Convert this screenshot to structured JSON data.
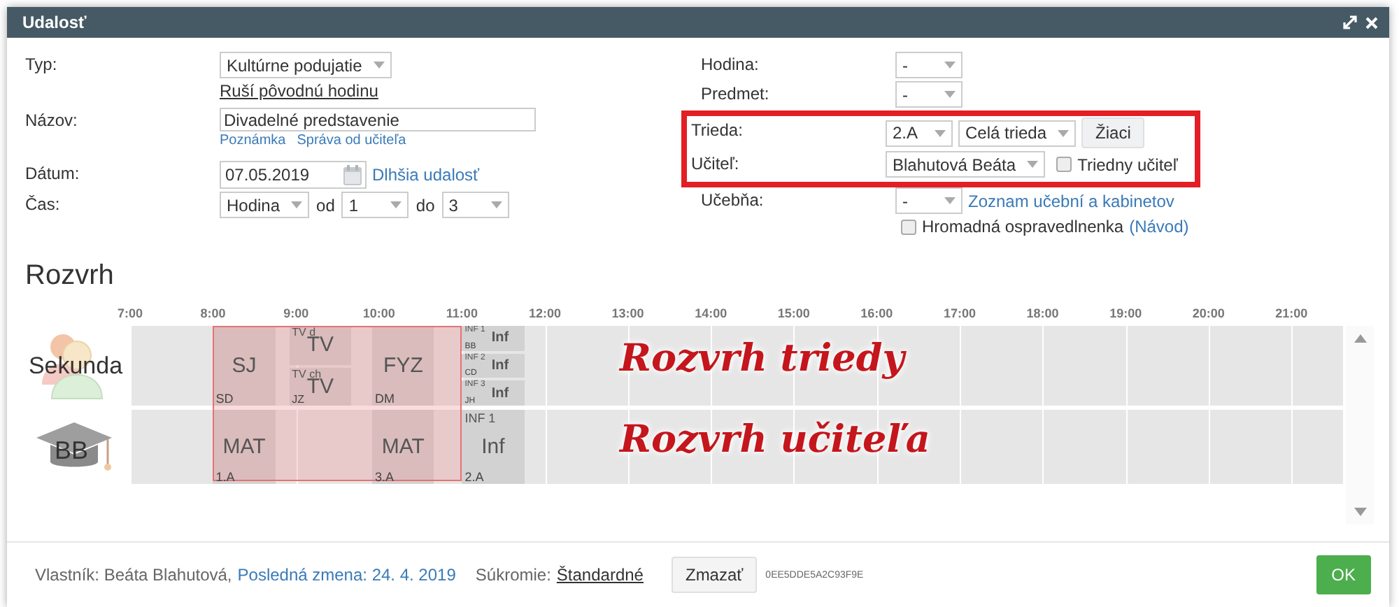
{
  "window": {
    "title": "Udalosť"
  },
  "form_left": [
    {
      "label": "Typ:",
      "controls": [
        {
          "kind": "select",
          "value": "Kultúrne podujatie"
        }
      ]
    },
    {
      "controls": [
        {
          "kind": "underlined_link",
          "text": "Ruší pôvodnú hodinu"
        }
      ]
    },
    {
      "label": "Názov:",
      "controls": [
        {
          "kind": "input",
          "value": "Divadelné predstavenie"
        }
      ]
    },
    {
      "controls": [
        {
          "kind": "small_link",
          "text": "Poznámka"
        },
        {
          "kind": "small_link",
          "text": "Správa od učiteľa"
        }
      ]
    },
    {
      "label": "Dátum:",
      "controls": [
        {
          "kind": "date",
          "value": "07.05.2019"
        },
        {
          "kind": "link",
          "text": "Dlhšia udalosť"
        }
      ]
    },
    {
      "label": "Čas:",
      "controls": [
        {
          "kind": "select",
          "value": "Hodina"
        },
        {
          "kind": "text",
          "text": "od"
        },
        {
          "kind": "select",
          "value": "1"
        },
        {
          "kind": "text",
          "text": "do"
        },
        {
          "kind": "select",
          "value": "3"
        }
      ]
    }
  ],
  "form_right": [
    {
      "label": "Hodina:",
      "highlighted": false,
      "controls": [
        {
          "kind": "select",
          "value": "-"
        }
      ]
    },
    {
      "label": "Predmet:",
      "highlighted": false,
      "controls": [
        {
          "kind": "select",
          "value": "-"
        }
      ]
    },
    {
      "label": "Trieda:",
      "highlighted": true,
      "controls": [
        {
          "kind": "select",
          "value": "2.A"
        },
        {
          "kind": "select",
          "value": "Celá trieda"
        },
        {
          "kind": "button",
          "text": "Žiaci"
        }
      ]
    },
    {
      "label": "Učiteľ:",
      "highlighted": true,
      "controls": [
        {
          "kind": "select",
          "value": "Blahutová Beáta"
        },
        {
          "kind": "checkbox",
          "text": "Triedny učiteľ",
          "checked": false
        }
      ]
    },
    {
      "label": "Učebňa:",
      "highlighted": false,
      "controls": [
        {
          "kind": "select",
          "value": "-"
        },
        {
          "kind": "link",
          "text": "Zoznam učební a kabinetov"
        }
      ]
    },
    {
      "highlighted": false,
      "controls": [
        {
          "kind": "checkbox",
          "text": "Hromadná ospravedlnenka",
          "checked": false
        },
        {
          "kind": "link",
          "text": "(Návod)"
        }
      ]
    }
  ],
  "schedule": {
    "title": "Rozvrh",
    "hours": [
      "7:00",
      "8:00",
      "9:00",
      "10:00",
      "11:00",
      "12:00",
      "13:00",
      "14:00",
      "15:00",
      "16:00",
      "17:00",
      "18:00",
      "19:00",
      "20:00",
      "21:00"
    ],
    "rows": [
      {
        "kind": "class",
        "label": "Sekunda",
        "annotation": "Rozvrh triedy",
        "cells": [
          {
            "kind": "lesson",
            "selected": true,
            "entries": [
              {
                "subject": "SJ",
                "note": "SD"
              }
            ]
          },
          {
            "kind": "lesson",
            "selected": true,
            "entries": [
              {
                "group": "TV d",
                "subject": "TV"
              },
              {
                "group": "TV ch",
                "subject": "TV",
                "note": "JZ"
              }
            ]
          },
          {
            "kind": "lesson",
            "selected": true,
            "entries": [
              {
                "subject": "FYZ",
                "note": "DM"
              }
            ]
          },
          {
            "kind": "lesson",
            "selected": false,
            "entries": [
              {
                "group": "INF 1",
                "subject": "Inf",
                "note": "BB"
              },
              {
                "group": "INF 2",
                "subject": "Inf",
                "note": "CD"
              },
              {
                "group": "INF 3",
                "subject": "Inf",
                "note": "JH"
              }
            ]
          }
        ]
      },
      {
        "kind": "teacher",
        "label": "BB",
        "annotation": "Rozvrh učiteľa",
        "cells": [
          {
            "kind": "lesson",
            "selected": true,
            "entries": [
              {
                "subject": "MAT",
                "note": "1.A"
              }
            ]
          },
          {
            "kind": "free",
            "selected": true
          },
          {
            "kind": "lesson",
            "selected": true,
            "entries": [
              {
                "subject": "MAT",
                "note": "3.A"
              }
            ]
          },
          {
            "kind": "lesson",
            "selected": false,
            "entries": [
              {
                "group": "INF 1",
                "subject": "Inf",
                "note": "2.A"
              }
            ]
          }
        ]
      }
    ]
  },
  "footer": {
    "owner": "Vlastník: Beáta Blahutová,",
    "last_change": "Posledná zmena: 24. 4. 2019",
    "privacy_label": "Súkromie:",
    "privacy_value": "Štandardné",
    "delete_button": "Zmazať",
    "code": "0EE5DDE5A2C93F9E",
    "ok_button": "OK"
  }
}
